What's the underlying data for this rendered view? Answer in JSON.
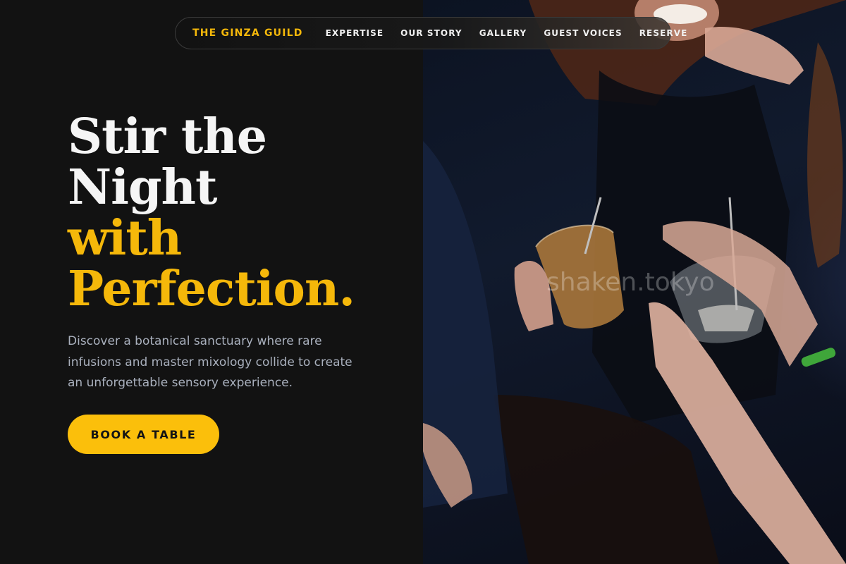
{
  "nav": {
    "brand": "THE GINZA GUILD",
    "links": [
      {
        "label": "EXPERTISE"
      },
      {
        "label": "OUR STORY"
      },
      {
        "label": "GALLERY"
      },
      {
        "label": "GUEST VOICES"
      },
      {
        "label": "RESERVE"
      }
    ]
  },
  "hero": {
    "title_line1": "Stir the",
    "title_line2": "Night",
    "title_line3": "with",
    "title_line4": "Perfection.",
    "description": "Discover a botanical sanctuary where rare infusions and master mixology collide to create an unforgettable sensory experience.",
    "cta_label": "BOOK A TABLE"
  },
  "photo": {
    "watermark": "shaken.tokyo"
  },
  "colors": {
    "accent": "#fbbf0b",
    "background": "#121212",
    "text_primary": "#f5f5f5",
    "text_secondary": "#a9b0bd"
  }
}
